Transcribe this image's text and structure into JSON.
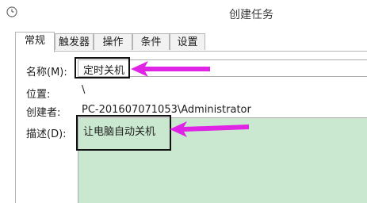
{
  "window": {
    "title": "创建任务"
  },
  "tabs": [
    {
      "label": "常规",
      "active": true
    },
    {
      "label": "触发器",
      "active": false
    },
    {
      "label": "操作",
      "active": false
    },
    {
      "label": "条件",
      "active": false
    },
    {
      "label": "设置",
      "active": false
    }
  ],
  "fields": {
    "name_label": "名称(M):",
    "name_value": "定时关机",
    "location_label": "位置:",
    "location_value": "\\",
    "author_label": "创建者:",
    "author_value": "PC-201607071053\\Administrator",
    "description_label": "描述(D):",
    "description_value": "让电脑自动关机"
  },
  "colors": {
    "annotation_arrow": "#e024e6",
    "description_background": "#c9e8cf",
    "annotation_box": "#111111"
  },
  "icons": {
    "window_icon": "clock-icon",
    "annotation": "arrow-left-icon"
  }
}
